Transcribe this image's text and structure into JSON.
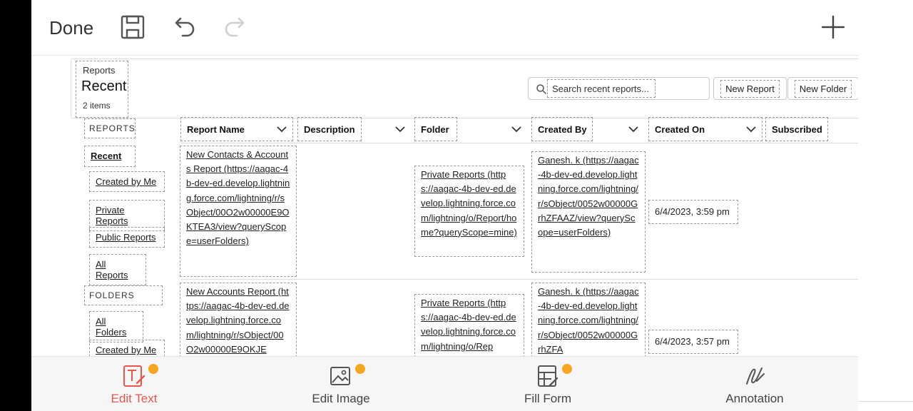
{
  "toolbar": {
    "done": "Done",
    "icons": [
      "save-icon",
      "undo-icon",
      "redo-icon",
      "plus-icon"
    ]
  },
  "header": {
    "section": "Reports",
    "title": "Recent",
    "count": "2 items",
    "search_placeholder": "Search recent reports...",
    "new_report": "New Report",
    "new_folder": "New Folder"
  },
  "sidebar": {
    "reports_heading": "REPORTS",
    "reports_items": [
      "Recent",
      "Created by Me",
      "Private Reports",
      "Public Reports",
      "All Reports"
    ],
    "folders_heading": "FOLDERS",
    "folders_items": [
      "All Folders",
      "Created by Me"
    ]
  },
  "table": {
    "columns": [
      "Report Name",
      "Description",
      "Folder",
      "Created By",
      "Created On",
      "Subscribed"
    ],
    "rows": [
      {
        "name": "New Contacts & Accounts Report (https://aagac-4b-dev-ed.develop.lightning.force.com/lightning/r/sObject/00O2w00000E9OKTEA3/view?queryScope=userFolders)",
        "description": "",
        "folder": "Private Reports (https://aagac-4b-dev-ed.develop.lightning.force.com/lightning/o/Report/home?queryScope=mine)",
        "created_by": "Ganesh. k (https://aagac-4b-dev-ed.develop.lightning.force.com/lightning/r/sObject/0052w00000GrhZFAAZ/view?queryScope=userFolders)",
        "created_on": "6/4/2023, 3:59 pm",
        "subscribed": ""
      },
      {
        "name": "New Accounts Report (https://aagac-4b-dev-ed.develop.lightning.force.com/lightning/r/sObject/00O2w00000E9OKJE",
        "description": "",
        "folder": "Private Reports (https://aagac-4b-dev-ed.develop.lightning.force.com/lightning/o/Rep",
        "created_by": "Ganesh. k (https://aagac-4b-dev-ed.develop.lightning.force.com/lightning/r/sObject/0052w00000GrhZFA",
        "created_on": "6/4/2023, 3:57 pm",
        "subscribed": ""
      }
    ]
  },
  "bottom_tools": [
    {
      "label": "Edit Text",
      "icon": "edit-text-icon",
      "active": true
    },
    {
      "label": "Edit Image",
      "icon": "edit-image-icon",
      "active": false
    },
    {
      "label": "Fill Form",
      "icon": "fill-form-icon",
      "active": false
    },
    {
      "label": "Annotation",
      "icon": "annotation-icon",
      "active": false
    }
  ],
  "colors": {
    "active": "#e8574f",
    "premium_badge": "#f5a623",
    "text": "#222222"
  }
}
